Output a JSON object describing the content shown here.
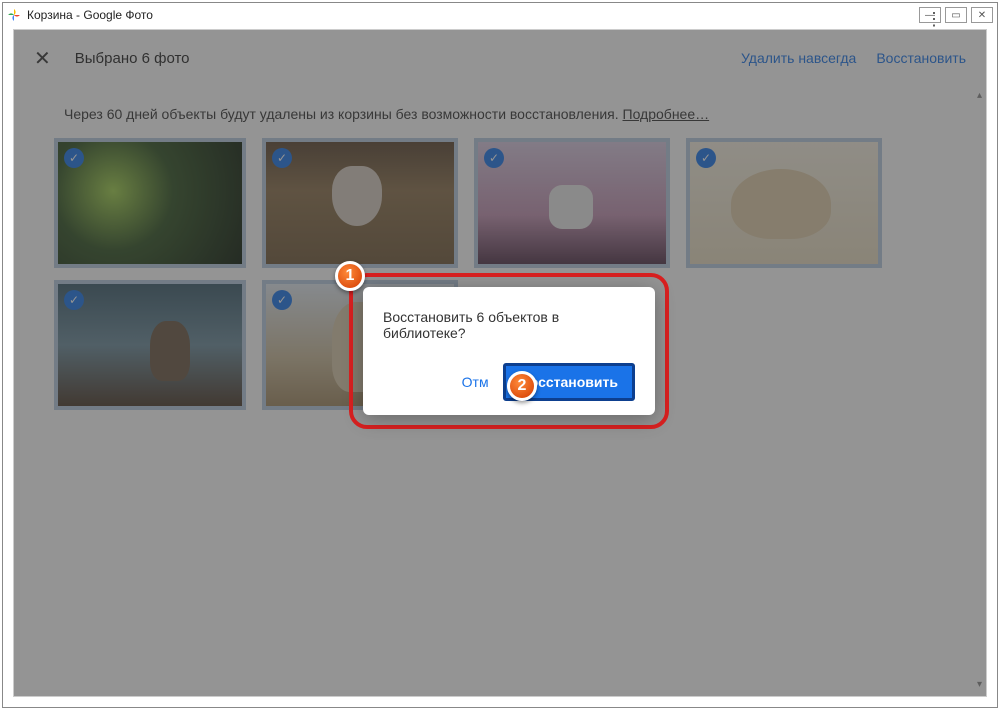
{
  "window": {
    "title": "Корзина - Google Фото"
  },
  "topbar": {
    "selection": "Выбрано 6 фото",
    "delete_forever": "Удалить навсегда",
    "restore": "Восстановить"
  },
  "info": {
    "text": "Через 60 дней объекты будут удалены из корзины без возможности восстановления. ",
    "more": "Подробнее…"
  },
  "dialog": {
    "message": "Восстановить 6 объектов в библиотеке?",
    "cancel": "Отм",
    "restore": "Восстановить"
  },
  "callouts": {
    "one": "1",
    "two": "2"
  }
}
